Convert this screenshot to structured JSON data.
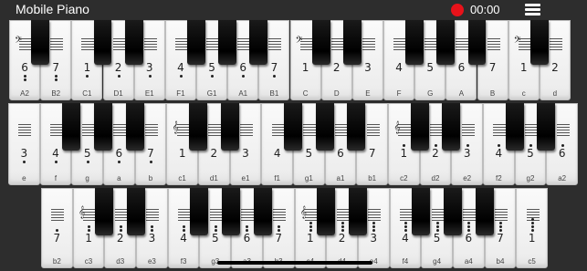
{
  "app": {
    "title": "Mobile Piano"
  },
  "recorder": {
    "time": "00:00",
    "color": "#e8121a"
  },
  "menu": {
    "icon": "hamburger-menu-icon"
  },
  "rows": [
    {
      "name": "row-1",
      "keys": [
        {
          "label": "A2",
          "num": "6",
          "dots": -2,
          "clef": "bass"
        },
        {
          "label": "B2",
          "num": "7",
          "dots": -2
        },
        {
          "label": "C1",
          "num": "1",
          "dots": -1
        },
        {
          "label": "D1",
          "num": "2",
          "dots": -1
        },
        {
          "label": "E1",
          "num": "3",
          "dots": -1
        },
        {
          "label": "F1",
          "num": "4",
          "dots": -1
        },
        {
          "label": "G1",
          "num": "5",
          "dots": -1
        },
        {
          "label": "A1",
          "num": "6",
          "dots": -1
        },
        {
          "label": "B1",
          "num": "7",
          "dots": -1
        },
        {
          "label": "C",
          "num": "1",
          "dots": 0,
          "clef": "bass"
        },
        {
          "label": "D",
          "num": "2",
          "dots": 0
        },
        {
          "label": "E",
          "num": "3",
          "dots": 0
        },
        {
          "label": "F",
          "num": "4",
          "dots": 0
        },
        {
          "label": "G",
          "num": "5",
          "dots": 0
        },
        {
          "label": "A",
          "num": "6",
          "dots": 0
        },
        {
          "label": "B",
          "num": "7",
          "dots": 0
        },
        {
          "label": "c",
          "num": "1",
          "dots": 0,
          "clef": "bass"
        },
        {
          "label": "d",
          "num": "2",
          "dots": 0
        }
      ]
    },
    {
      "name": "row-2",
      "keys": [
        {
          "label": "e",
          "num": "3",
          "dots": -1
        },
        {
          "label": "f",
          "num": "4",
          "dots": -1
        },
        {
          "label": "g",
          "num": "5",
          "dots": -1
        },
        {
          "label": "a",
          "num": "6",
          "dots": -1
        },
        {
          "label": "b",
          "num": "7",
          "dots": -1
        },
        {
          "label": "c1",
          "num": "1",
          "dots": 0,
          "clef": "treble"
        },
        {
          "label": "d1",
          "num": "2",
          "dots": 0
        },
        {
          "label": "e1",
          "num": "3",
          "dots": 0
        },
        {
          "label": "f1",
          "num": "4",
          "dots": 0
        },
        {
          "label": "g1",
          "num": "5",
          "dots": 0
        },
        {
          "label": "a1",
          "num": "6",
          "dots": 0
        },
        {
          "label": "b1",
          "num": "7",
          "dots": 0
        },
        {
          "label": "c2",
          "num": "1",
          "dots": 1,
          "clef": "treble"
        },
        {
          "label": "d2",
          "num": "2",
          "dots": 1
        },
        {
          "label": "e2",
          "num": "3",
          "dots": 1
        },
        {
          "label": "f2",
          "num": "4",
          "dots": 1
        },
        {
          "label": "g2",
          "num": "5",
          "dots": 1
        },
        {
          "label": "a2",
          "num": "6",
          "dots": 1
        }
      ]
    },
    {
      "name": "row-3",
      "keys": [
        {
          "label": "b2",
          "num": "7",
          "dots": 1
        },
        {
          "label": "c3",
          "num": "1",
          "dots": 2,
          "clef": "treble"
        },
        {
          "label": "d3",
          "num": "2",
          "dots": 2
        },
        {
          "label": "e3",
          "num": "3",
          "dots": 2
        },
        {
          "label": "f3",
          "num": "4",
          "dots": 2
        },
        {
          "label": "g3",
          "num": "5",
          "dots": 2
        },
        {
          "label": "a3",
          "num": "6",
          "dots": 2
        },
        {
          "label": "b3",
          "num": "7",
          "dots": 2
        },
        {
          "label": "c4",
          "num": "1",
          "dots": 3,
          "clef": "treble"
        },
        {
          "label": "d4",
          "num": "2",
          "dots": 3
        },
        {
          "label": "e4",
          "num": "3",
          "dots": 3
        },
        {
          "label": "f4",
          "num": "4",
          "dots": 3
        },
        {
          "label": "g4",
          "num": "5",
          "dots": 3
        },
        {
          "label": "a4",
          "num": "6",
          "dots": 3
        },
        {
          "label": "b4",
          "num": "7",
          "dots": 3
        },
        {
          "label": "c5",
          "num": "1",
          "dots": 4
        }
      ]
    }
  ]
}
